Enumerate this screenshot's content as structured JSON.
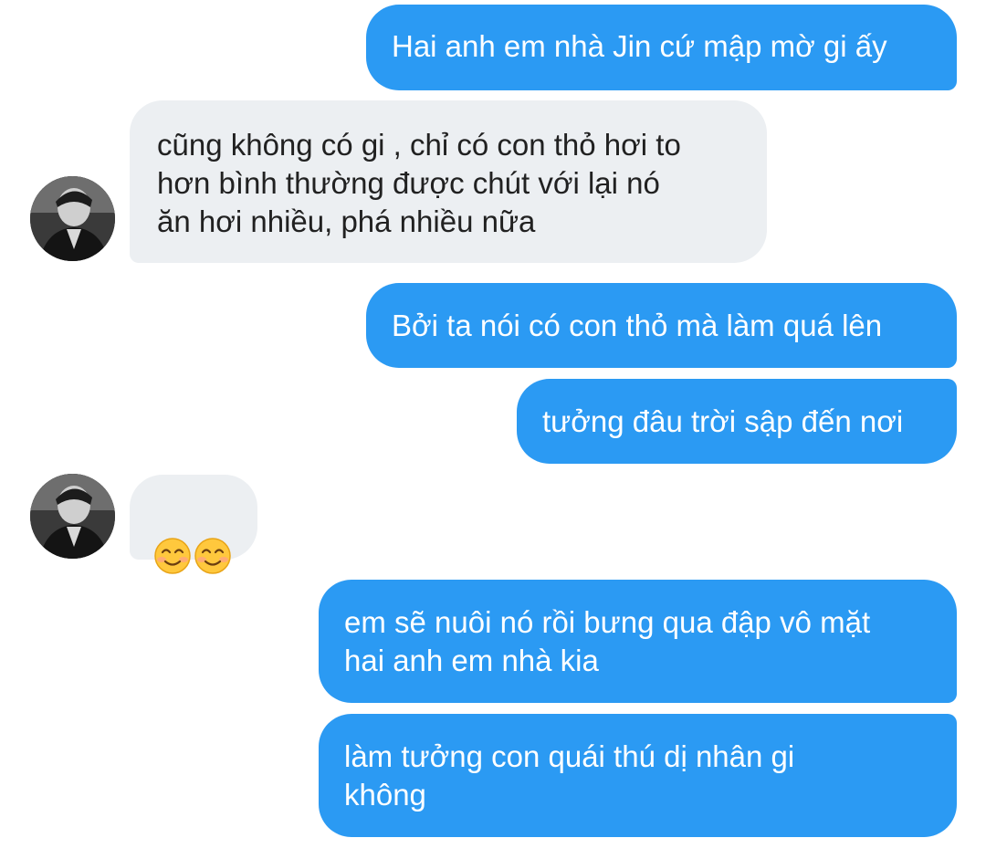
{
  "messages": [
    {
      "side": "sent",
      "text": "Hai anh em nhà Jin cứ mập mờ gi ấy"
    },
    {
      "side": "recv",
      "text": "cũng không có gi , chỉ có con thỏ hơi to\nhơn bình  thường được chút với lại nó\năn hơi nhiều, phá nhiều nữa"
    },
    {
      "side": "sent",
      "text": "Bởi ta nói có con thỏ mà làm quá lên"
    },
    {
      "side": "sent",
      "text": "tưởng đâu trời sập đến nơi"
    },
    {
      "side": "recv",
      "emoji": "smiling-face-with-smiling-eyes",
      "emoji_count": 2
    },
    {
      "side": "sent",
      "text": "em sẽ nuôi nó rồi bưng qua đập vô mặt\nhai anh em nhà kia"
    },
    {
      "side": "sent",
      "text": "làm tưởng con quái thú dị nhân gi\nkhông"
    }
  ],
  "colors": {
    "sent_bubble": "#2b9af3",
    "sent_text": "#ffffff",
    "recv_bubble": "#eceff2",
    "recv_text": "#212121",
    "background": "#ffffff"
  }
}
